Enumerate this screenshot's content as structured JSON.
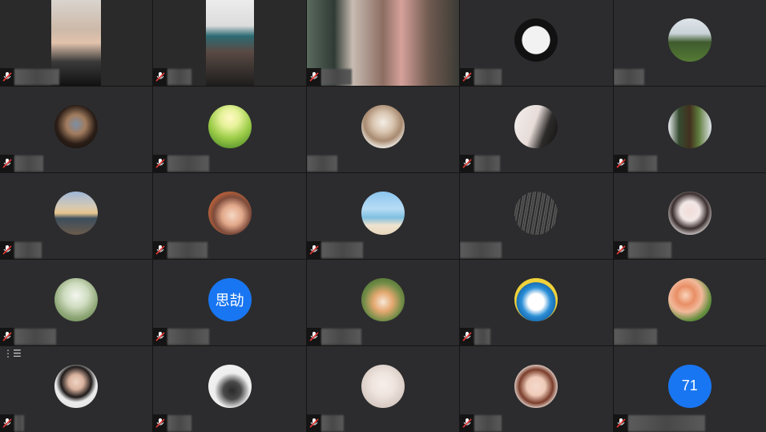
{
  "tiles": [
    {
      "kind": "video"
    },
    {
      "kind": "video"
    },
    {
      "kind": "video"
    },
    {
      "kind": "avatar",
      "icon": "calligraphy-logo-avatar"
    },
    {
      "kind": "avatar",
      "icon": "tree-avatar"
    },
    {
      "kind": "avatar",
      "icon": "photo-avatar"
    },
    {
      "kind": "avatar",
      "icon": "flowers-avatar"
    },
    {
      "kind": "avatar",
      "icon": "kitten-avatar"
    },
    {
      "kind": "avatar",
      "icon": "portrait-avatar"
    },
    {
      "kind": "avatar",
      "icon": "person-avatar"
    },
    {
      "kind": "avatar",
      "icon": "sunset-avatar"
    },
    {
      "kind": "avatar",
      "icon": "anime-avatar"
    },
    {
      "kind": "avatar",
      "icon": "beach-avatar"
    },
    {
      "kind": "avatar",
      "icon": "dark-grass-avatar"
    },
    {
      "kind": "avatar",
      "icon": "illustration-avatar"
    },
    {
      "kind": "avatar",
      "icon": "nature-avatar"
    },
    {
      "kind": "text-avatar",
      "initials": "思劼",
      "color": "#1976f2"
    },
    {
      "kind": "avatar",
      "icon": "corgi-avatar"
    },
    {
      "kind": "avatar",
      "icon": "doraemon-avatar"
    },
    {
      "kind": "avatar",
      "icon": "roses-avatar"
    },
    {
      "kind": "avatar",
      "icon": "woman-avatar"
    },
    {
      "kind": "avatar",
      "icon": "horse-painting-avatar"
    },
    {
      "kind": "avatar",
      "icon": "sketch-avatar"
    },
    {
      "kind": "avatar",
      "icon": "cartoon-girl-avatar"
    },
    {
      "kind": "text-avatar",
      "initials": "71",
      "color": "#1976f2"
    }
  ]
}
